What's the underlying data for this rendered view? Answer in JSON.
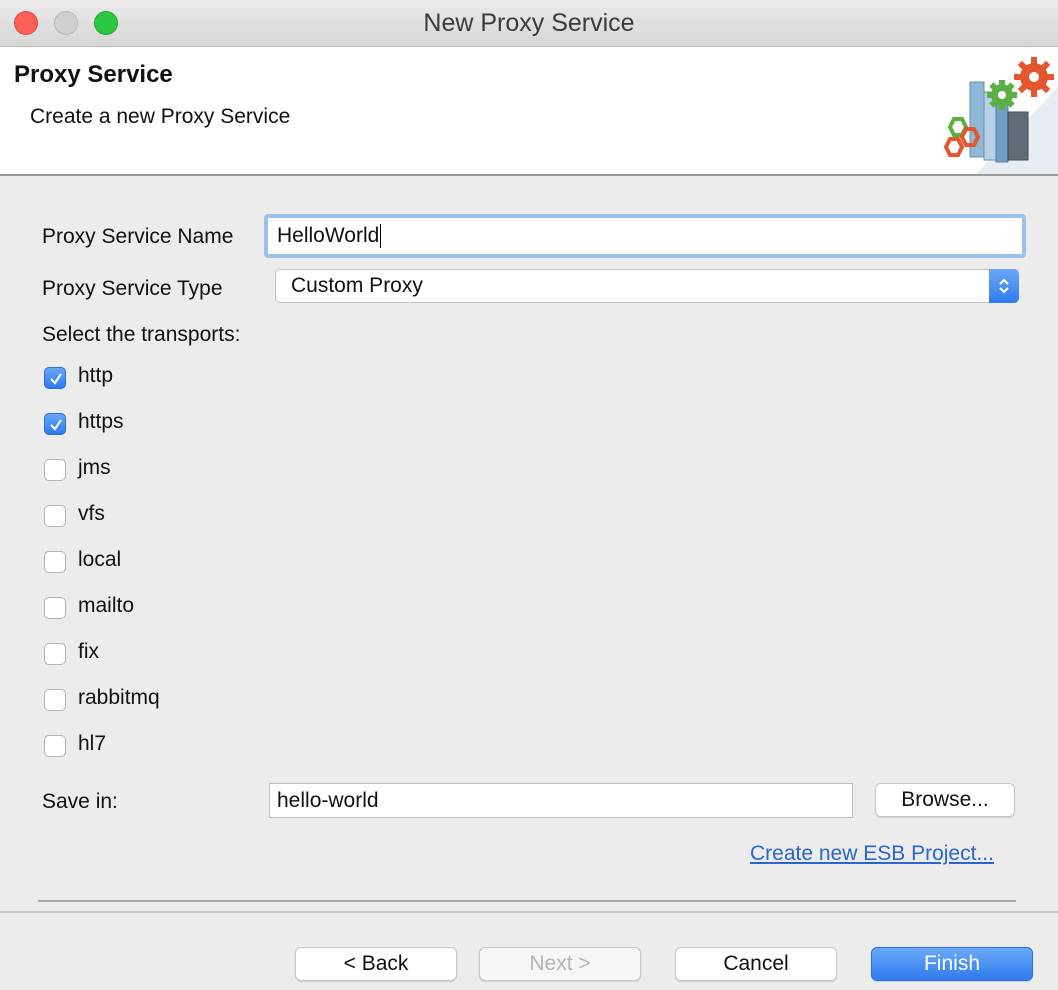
{
  "window": {
    "title": "New Proxy Service"
  },
  "header": {
    "title": "Proxy Service",
    "description": "Create a new Proxy Service"
  },
  "form": {
    "name_label": "Proxy Service Name",
    "name_value": "HelloWorld",
    "type_label": "Proxy Service Type",
    "type_value": "Custom Proxy",
    "transports_label": "Select the transports:",
    "transports": [
      {
        "label": "http",
        "checked": true
      },
      {
        "label": "https",
        "checked": true
      },
      {
        "label": "jms",
        "checked": false
      },
      {
        "label": "vfs",
        "checked": false
      },
      {
        "label": "local",
        "checked": false
      },
      {
        "label": "mailto",
        "checked": false
      },
      {
        "label": "fix",
        "checked": false
      },
      {
        "label": "rabbitmq",
        "checked": false
      },
      {
        "label": "hl7",
        "checked": false
      }
    ],
    "save_label": "Save in:",
    "save_value": "hello-world",
    "browse_label": "Browse...",
    "create_link": "Create new ESB Project..."
  },
  "buttons": {
    "back": "< Back",
    "next": "Next >",
    "cancel": "Cancel",
    "finish": "Finish"
  },
  "colors": {
    "accent": "#2f7bef",
    "link": "#2b66c9",
    "focus_ring": "#9ec2ef"
  }
}
